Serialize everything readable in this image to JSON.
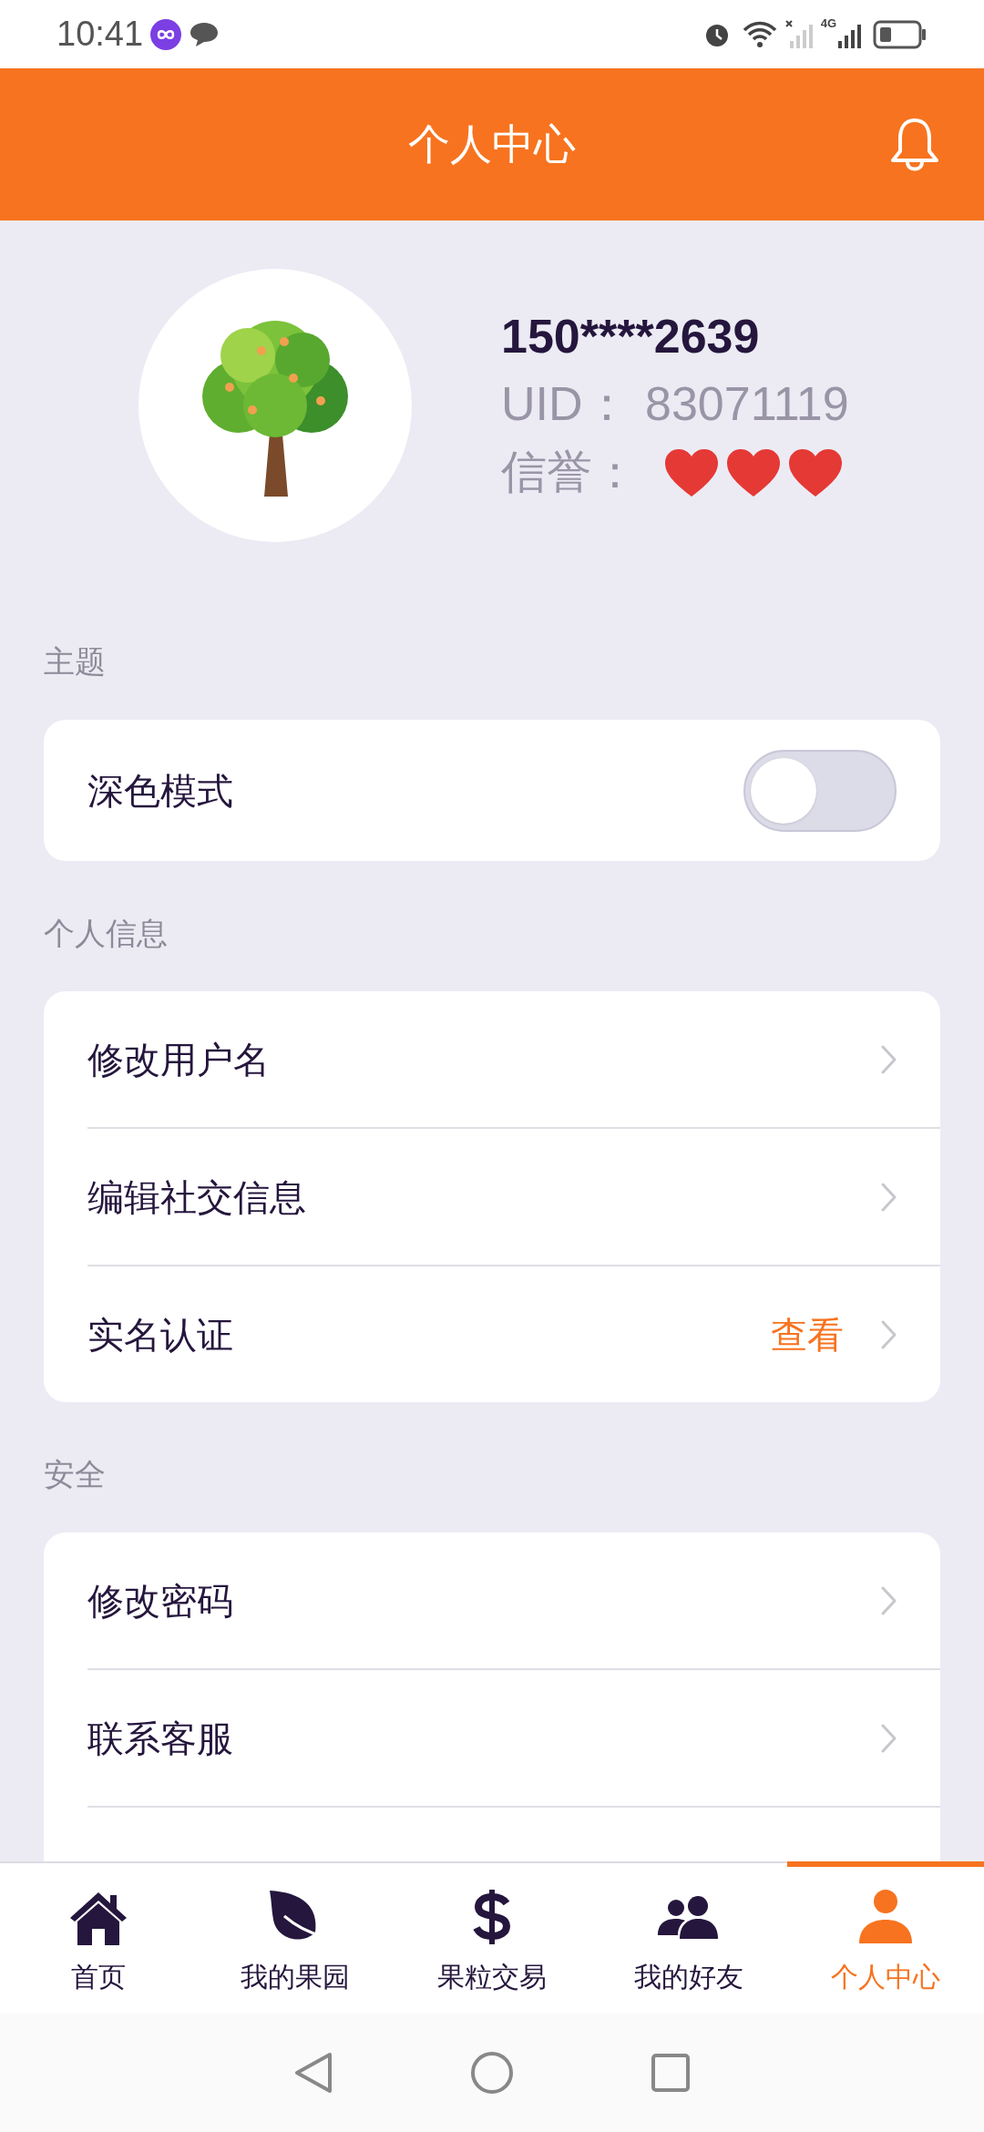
{
  "status_bar": {
    "time": "10:41",
    "network": "4G"
  },
  "header": {
    "title": "个人中心"
  },
  "profile": {
    "phone": "150****2639",
    "uid_label": "UID：",
    "uid": "83071119",
    "credit_label": "信誉：",
    "stars": 3
  },
  "sections": [
    {
      "title": "主题",
      "rows": [
        {
          "kind": "toggle",
          "label": "深色模式",
          "on": false
        }
      ]
    },
    {
      "title": "个人信息",
      "rows": [
        {
          "kind": "link",
          "label": "修改用户名"
        },
        {
          "kind": "link",
          "label": "编辑社交信息"
        },
        {
          "kind": "link",
          "label": "实名认证",
          "value": "查看"
        }
      ]
    },
    {
      "title": "安全",
      "rows": [
        {
          "kind": "link",
          "label": "修改密码"
        },
        {
          "kind": "link",
          "label": "联系客服"
        }
      ]
    }
  ],
  "tab_bar": [
    {
      "label": "首页",
      "selected": false
    },
    {
      "label": "我的果园",
      "selected": false
    },
    {
      "label": "果粒交易",
      "selected": false
    },
    {
      "label": "我的好友",
      "selected": false
    },
    {
      "label": "个人中心",
      "selected": true
    }
  ]
}
